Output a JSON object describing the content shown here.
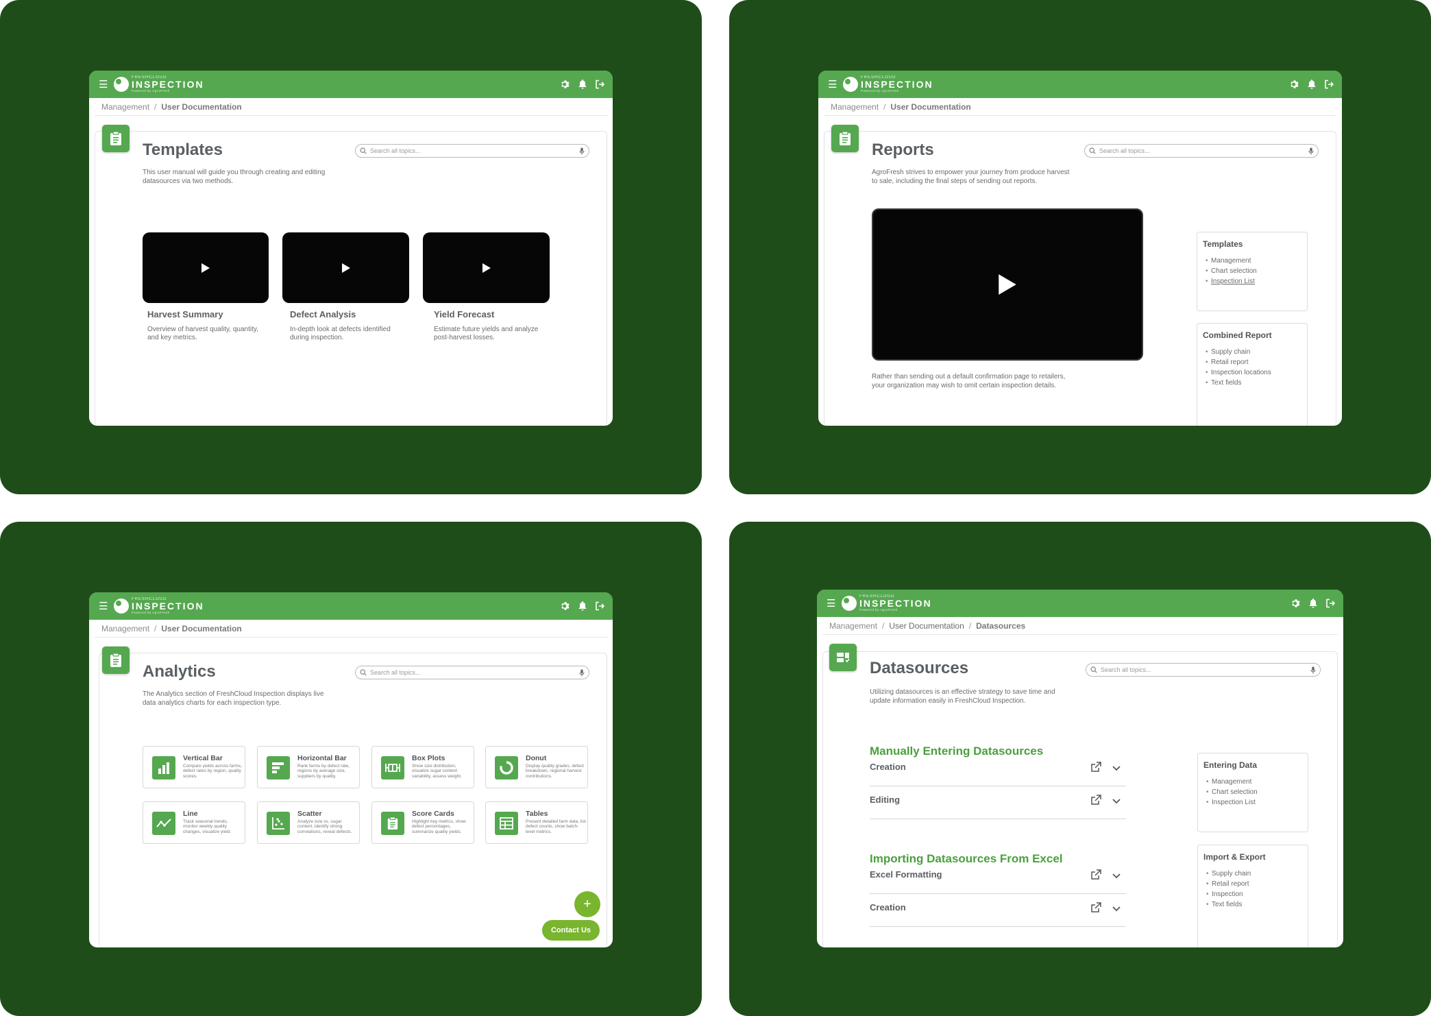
{
  "app": {
    "logo_pre": "FRESHCLOUD",
    "logo_main": "INSPECTION",
    "logo_sub": "Powered by AgroFresh"
  },
  "colors": {
    "frame": "#1e4d1a",
    "brand": "#55a84f",
    "accent": "#79b52e",
    "heading_green": "#4aa03d"
  },
  "search_placeholder": "Search all topics...",
  "templates_screen": {
    "crumbs": [
      "Management",
      "User Documentation"
    ],
    "title": "Templates",
    "description": "This user manual will guide you through creating and editing datasources via two methods.",
    "videos": [
      {
        "title": "Harvest Summary",
        "desc": "Overview of harvest quality, quantity, and key metrics."
      },
      {
        "title": "Defect Analysis",
        "desc": "In-depth look at defects identified during inspection."
      },
      {
        "title": "Yield Forecast",
        "desc": "Estimate future yields and analyze post-harvest losses."
      }
    ]
  },
  "reports_screen": {
    "crumbs": [
      "Management",
      "User Documentation"
    ],
    "title": "Reports",
    "description": "AgroFresh strives to empower your journey from produce harvest to sale, including the final steps of sending out reports.",
    "caption": "Rather than sending out a default confirmation page to retailers, your organization may wish to omit certain inspection details.",
    "side": [
      {
        "title": "Templates",
        "items": [
          "Management",
          "Chart selection",
          "Inspection List"
        ]
      },
      {
        "title": "Combined Report",
        "items": [
          "Supply chain",
          "Retail report",
          "Inspection locations",
          "Text fields"
        ]
      }
    ]
  },
  "analytics_screen": {
    "crumbs": [
      "Management",
      "User Documentation"
    ],
    "title": "Analytics",
    "description": "The Analytics section of FreshCloud Inspection displays live data analytics charts for each inspection type.",
    "charts": [
      {
        "name": "Vertical Bar",
        "desc": "Compare yields across farms, defect rates by region, quality scores.",
        "icon": "vertical-bar-icon"
      },
      {
        "name": "Horizontal Bar",
        "desc": "Rank farms by defect rate, regions by average size, suppliers by quality.",
        "icon": "horizontal-bar-icon"
      },
      {
        "name": "Box Plots",
        "desc": "Show size distribution, visualize sugar content variability, assess weight.",
        "icon": "box-plot-icon"
      },
      {
        "name": "Donut",
        "desc": "Display quality grades, defect breakdown, regional harvest contributions.",
        "icon": "donut-icon"
      },
      {
        "name": "Line",
        "desc": "Track seasonal trends, monitor weekly quality changes, visualize yield.",
        "icon": "line-chart-icon"
      },
      {
        "name": "Scatter",
        "desc": "Analyze size vs. sugar content, identify strong correlations, reveal defects.",
        "icon": "scatter-icon"
      },
      {
        "name": "Score Cards",
        "desc": "Highlight key metrics, show defect percentages, summarize quality yields.",
        "icon": "score-card-icon"
      },
      {
        "name": "Tables",
        "desc": "Present detailed farm data, list defect counts, show batch-level metrics.",
        "icon": "table-icon"
      }
    ],
    "fab_symbol": "+",
    "contact_label": "Contact Us"
  },
  "datasources_screen": {
    "crumbs": [
      "Management",
      "User Documentation",
      "Datasources"
    ],
    "title": "Datasources",
    "description": "Utilizing datasources is an effective strategy to save time and update information easily in FreshCloud Inspection.",
    "sections": [
      {
        "heading": "Manually Entering Datasources",
        "rows": [
          "Creation",
          "Editing"
        ]
      },
      {
        "heading": "Importing Datasources From Excel",
        "rows": [
          "Excel Formatting",
          "Creation"
        ]
      }
    ],
    "side": [
      {
        "title": "Entering Data",
        "items": [
          "Management",
          "Chart selection",
          "Inspection List"
        ]
      },
      {
        "title": "Import & Export",
        "items": [
          "Supply chain",
          "Retail report",
          "Inspection",
          "Text fields"
        ]
      }
    ]
  }
}
